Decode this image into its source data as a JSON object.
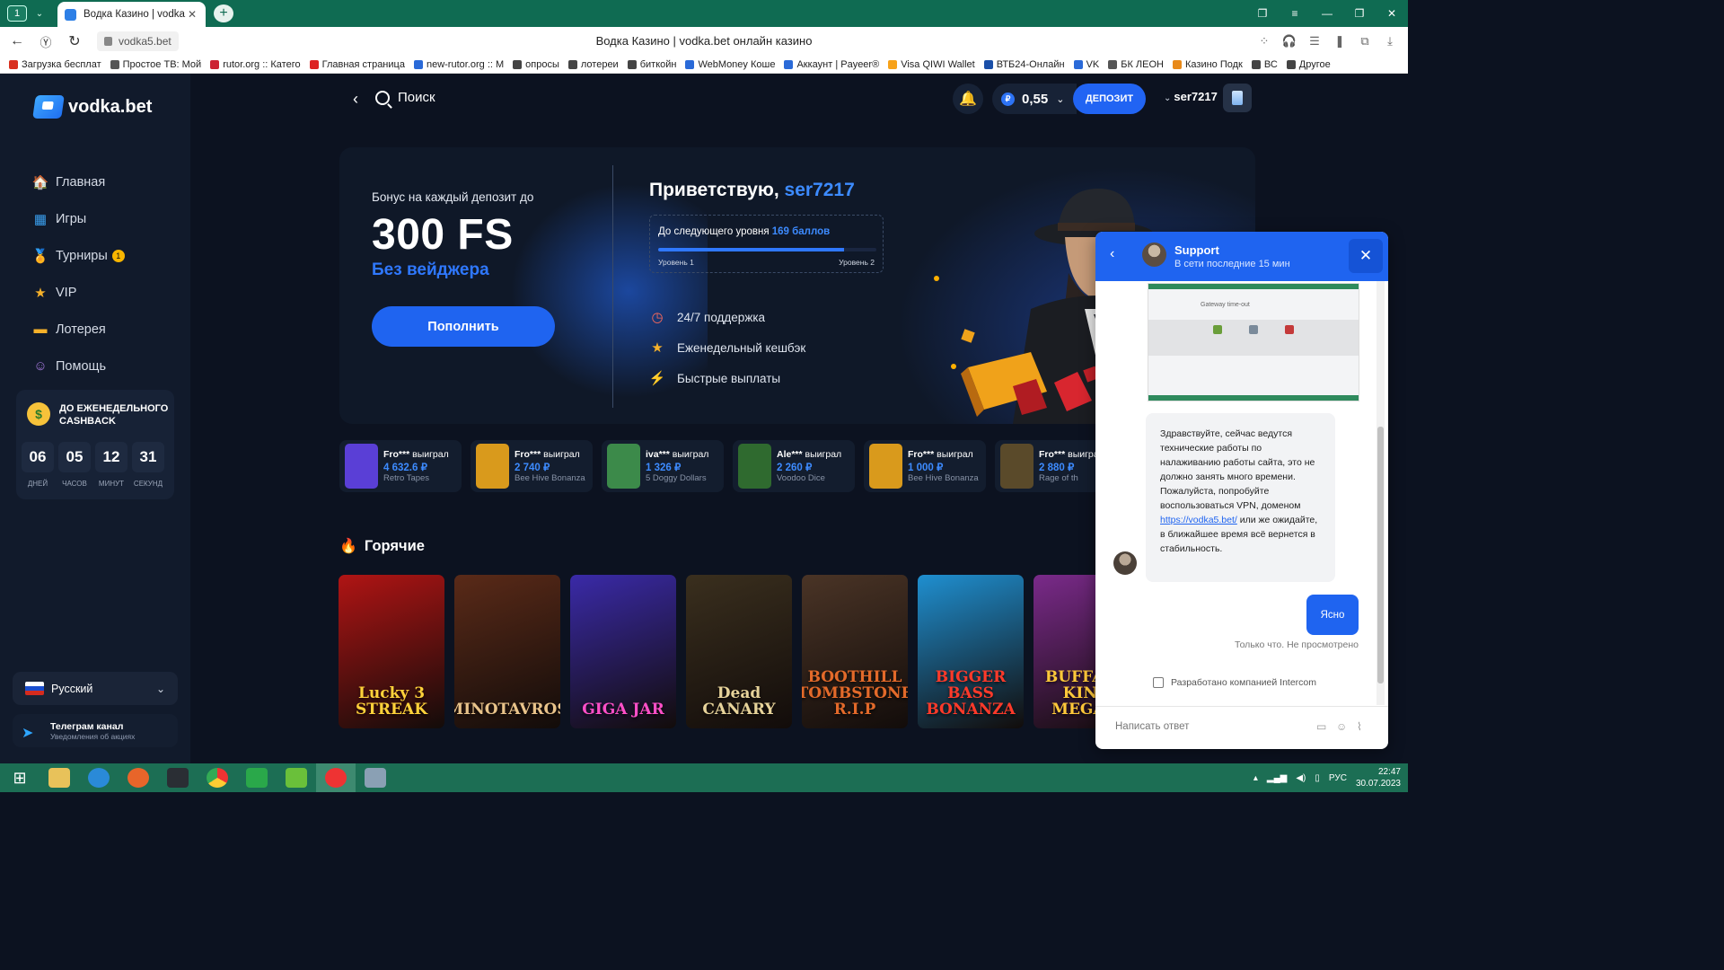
{
  "browser": {
    "tab_count": "1",
    "tab_title": "Водка Казино | vodka.b",
    "url": "vodka5.bet",
    "page_title": "Водка Казино | vodka.bet онлайн казино",
    "bookmarks": [
      "Загрузка бесплат",
      "Простое ТВ: Мой",
      "rutor.org :: Катего",
      "Главная страница",
      "new-rutor.org :: M",
      "опросы",
      "лотереи",
      "биткойн",
      "WebMoney Коше",
      "Аккаунт | Payeer®",
      "Visa QIWI Wallet",
      "ВТБ24-Онлайн",
      "VK",
      "БК ЛЕОН",
      "Казино Подк",
      "ВС",
      "Другое"
    ]
  },
  "site": {
    "logo": "vodka.bet",
    "search_label": "Поиск",
    "balance": "0,55",
    "deposit_label": "ДЕПОЗИТ",
    "username": "ser7217",
    "menu": [
      {
        "label": "Главная",
        "icon": "home-icon"
      },
      {
        "label": "Игры",
        "icon": "games-icon"
      },
      {
        "label": "Турниры",
        "icon": "tournament-icon",
        "badge": "1"
      },
      {
        "label": "VIP",
        "icon": "star-icon"
      },
      {
        "label": "Лотерея",
        "icon": "ticket-icon"
      },
      {
        "label": "Помощь",
        "icon": "help-icon"
      }
    ],
    "cashback": {
      "title": "ДО ЕЖЕНЕДЕЛЬНОГО CASHBACK",
      "timer": [
        {
          "value": "06",
          "label": "ДНЕЙ"
        },
        {
          "value": "05",
          "label": "ЧАСОВ"
        },
        {
          "value": "12",
          "label": "МИНУТ"
        },
        {
          "value": "31",
          "label": "СЕКУНД"
        }
      ]
    },
    "language": "Русский",
    "telegram": {
      "title": "Телеграм канал",
      "subtitle": "Уведомления об акциях"
    }
  },
  "hero": {
    "subtitle": "Бонус на каждый депозит до",
    "amount": "300 FS",
    "note": "Без вейджера",
    "button": "Пополнить",
    "greeting": "Приветствую,",
    "greeting_name": "ser7217",
    "level_text": "До следующего уровня",
    "level_points": "169 баллов",
    "level_progress": 0.85,
    "level_from": "Уровень 1",
    "level_to": "Уровень 2",
    "features": [
      "24/7 поддержка",
      "Еженедельный кешбэк",
      "Быстрые выплаты"
    ]
  },
  "winners": [
    {
      "name": "Fro***",
      "action": "выиграл",
      "amount": "4 632.6 ₽",
      "game": "Retro Tapes",
      "color": "#5a3fd6"
    },
    {
      "name": "Fro***",
      "action": "выиграл",
      "amount": "2 740 ₽",
      "game": "Bee Hive Bonanza",
      "color": "#d99a1c"
    },
    {
      "name": "iva***",
      "action": "выиграл",
      "amount": "1 326 ₽",
      "game": "5 Doggy Dollars",
      "color": "#3c8a4a"
    },
    {
      "name": "Ale***",
      "action": "выиграл",
      "amount": "2 260 ₽",
      "game": "Voodoo Dice",
      "color": "#2f6a2f"
    },
    {
      "name": "Fro***",
      "action": "выиграл",
      "amount": "1 000 ₽",
      "game": "Bee Hive Bonanza",
      "color": "#d99a1c"
    },
    {
      "name": "Fro***",
      "action": "выиграл",
      "amount": "2 880 ₽",
      "game": "Rage of th",
      "color": "#5a4a2a"
    }
  ],
  "hot": {
    "title": "Горячие",
    "games": [
      {
        "title": "Lucky 3 STREAK",
        "color": "#b01414",
        "text_color": "#ffd23a"
      },
      {
        "title": "MINOTAVROS",
        "color": "#5a2a18",
        "text_color": "#e9c38a"
      },
      {
        "title": "GIGA JAR",
        "color": "#3a2aa8",
        "text_color": "#ff4fc8"
      },
      {
        "title": "Dead CANARY",
        "color": "#3a2f1e",
        "text_color": "#e7d39a"
      },
      {
        "title": "BOOTHILL TOMBSTONE R.I.P",
        "color": "#4a3426",
        "text_color": "#e36a2a"
      },
      {
        "title": "BIGGER BASS BONANZA",
        "color": "#1f8fd0",
        "text_color": "#ff3a2a"
      },
      {
        "title": "BUFFALO KING MEGAW",
        "color": "#7a2a8a",
        "text_color": "#ffc93a"
      }
    ]
  },
  "chat": {
    "name": "Support",
    "status": "В сети последние 15 мин",
    "screenshot_caption": "Gateway time-out",
    "message_before_link": "Здравствуйте, сейчас ведутся технические работы по налаживанию работы сайта, это не должно занять много времени. Пожалуйста, попробуйте воспользоваться VPN, доменом ",
    "message_link": "https://vodka5.bet/",
    "message_after_link": " или же ожидайте, в ближайшее время всё вернется в стабильность.",
    "my_message": "Ясно",
    "seen": "Только что. Не просмотрено",
    "powered": "Разработано компанией Intercom",
    "placeholder": "Написать ответ"
  },
  "taskbar": {
    "lang": "РУС",
    "time": "22:47",
    "date": "30.07.2023"
  }
}
